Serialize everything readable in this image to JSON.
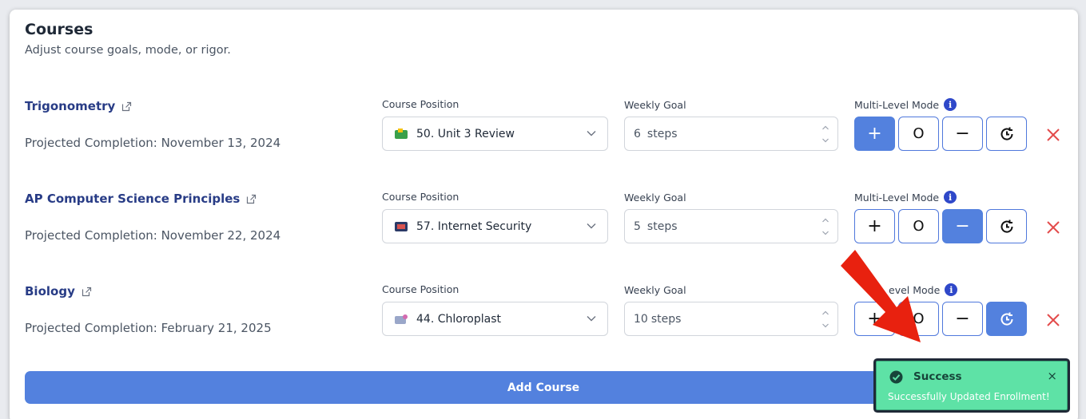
{
  "header": {
    "title": "Courses",
    "subtitle": "Adjust course goals, mode, or rigor."
  },
  "labels": {
    "course_position": "Course Position",
    "weekly_goal": "Weekly Goal",
    "multi_level_mode": "Multi-Level Mode",
    "multi_level_mode_partial": "evel Mode"
  },
  "courses": [
    {
      "name": "Trigonometry",
      "projected": "Projected Completion: November 13, 2024",
      "position": "50. Unit 3 Review",
      "weekly_goal": "6",
      "weekly_unit": "steps",
      "active_mode": "plus"
    },
    {
      "name": "AP Computer Science Principles",
      "projected": "Projected Completion: November 22, 2024",
      "position": "57. Internet Security",
      "weekly_goal": "5",
      "weekly_unit": "steps",
      "active_mode": "minus"
    },
    {
      "name": "Biology",
      "projected": "Projected Completion: February 21, 2025",
      "position": "44. Chloroplast",
      "weekly_goal": "10",
      "weekly_unit": "steps",
      "active_mode": "clock"
    }
  ],
  "mode_symbols": {
    "plus": "+",
    "circle": "O",
    "minus": "−"
  },
  "add_course_label": "Add Course",
  "toast": {
    "title": "Success",
    "message": "Successfully Updated Enrollment!",
    "close": "×"
  },
  "colors": {
    "accent": "#5381de",
    "course_link": "#283c86",
    "delete": "#e34b4b",
    "toast_bg": "#5ee2a6",
    "annotation_arrow": "#e8210f"
  }
}
